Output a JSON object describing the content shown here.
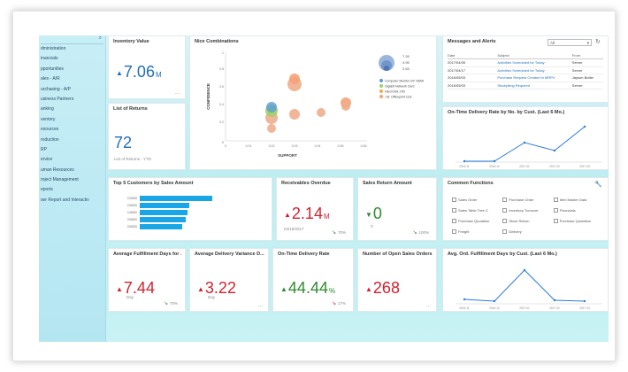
{
  "sidebar": {
    "items": [
      "dministration",
      "inancials",
      "pportunities",
      "ales - A/R",
      "urchasing - A/P",
      "usiness Partners",
      "anking",
      "ventory",
      "esources",
      "roduction",
      "RP",
      "ervice",
      "uman Resources",
      "roject Management",
      "eports",
      "ser Report and Interactiv"
    ]
  },
  "inventory_value": {
    "title": "Inventory Value",
    "value": "7.06",
    "unit": "M",
    "sub": "",
    "dots": "..."
  },
  "list_of_returns": {
    "title": "List of Returns",
    "value": "72",
    "sub": "List of Returns - YTD"
  },
  "nice_combinations": {
    "title": "Nice Combinations",
    "xlabel": "SUPPORT",
    "ylabel": "CONFIDENCE",
    "size_legend": [
      "7.26",
      "4.95",
      "2.63"
    ],
    "color_legend": [
      "Computer Monitor 24\" HDMI",
      "Gigabit Network Card",
      "Hard Disk 1TB",
      "J.B. Officeprint 1111"
    ]
  },
  "messages": {
    "title": "Messages and Alerts",
    "filter": "All",
    "columns": [
      "Date",
      "Subject",
      "From"
    ],
    "rows": [
      [
        "2017/04/05",
        "Activities Scheduled for Today",
        "Server"
      ],
      [
        "2017/04/17",
        "Activities Scheduled for Today",
        "Server"
      ],
      [
        "2016/05/03",
        "Purchase Request Created in MRPV",
        "Jayson Butler"
      ],
      [
        "2016/05/03",
        "Stockpiling Required",
        "Server"
      ]
    ]
  },
  "ontime_by_cust": {
    "title": "On-Time Delivery Rate by No. by Cust. (Last 6 Mo.)",
    "x_labels": [
      "2016.11",
      "2016.12",
      "2017.01",
      "2017.02",
      "2017.03"
    ]
  },
  "top_customers": {
    "title": "Top 5 Customers by Sales Amount",
    "categories": [
      "C20000",
      "C30000",
      "C40000",
      "C50000",
      "C60000"
    ]
  },
  "receivables": {
    "title": "Receivables Overdue",
    "value": "2.14",
    "unit": "M",
    "sub": "04/18/2017",
    "foot": "70%"
  },
  "sales_return": {
    "title": "Sales Return Amount",
    "value": "0",
    "sub": "0",
    "foot": "100%"
  },
  "common_functions": {
    "title": "Common Functions",
    "items": [
      "Sales Order",
      "Purchase Order",
      "Item Master Data",
      "Sales Table Tree C",
      "Inventory Turnover",
      "Financials",
      "Purchase Quotation",
      "Stock Return",
      "Purchase Quotation",
      "Freight",
      "Delivery"
    ]
  },
  "fulfillment_days": {
    "title": "Average Fulfillment Days for ...",
    "value": "7.44",
    "sub": "Day",
    "foot": "70%"
  },
  "delivery_variance": {
    "title": "Average Delivery Variance D...",
    "value": "3.22",
    "sub": "Day",
    "dots": "..."
  },
  "ontime_rate": {
    "title": "On-Time Delivery Rate",
    "value": "44.44",
    "unit": "%",
    "foot": "17%"
  },
  "open_orders": {
    "title": "Number of Open Sales Orders",
    "value": "268",
    "dots": "..."
  },
  "fulfillment_by_cust": {
    "title": "Avg. Ord. Fulfillment Days by Cust. (Last 6 Mo.)",
    "x_labels": [
      "2016.11",
      "2016.12",
      "2017.01",
      "2017.02",
      "2017.03"
    ]
  },
  "colors": {
    "blue": "#1f6fb8",
    "red": "#d3212d",
    "green": "#2e8b2e",
    "bar": "#19a6e6"
  }
}
